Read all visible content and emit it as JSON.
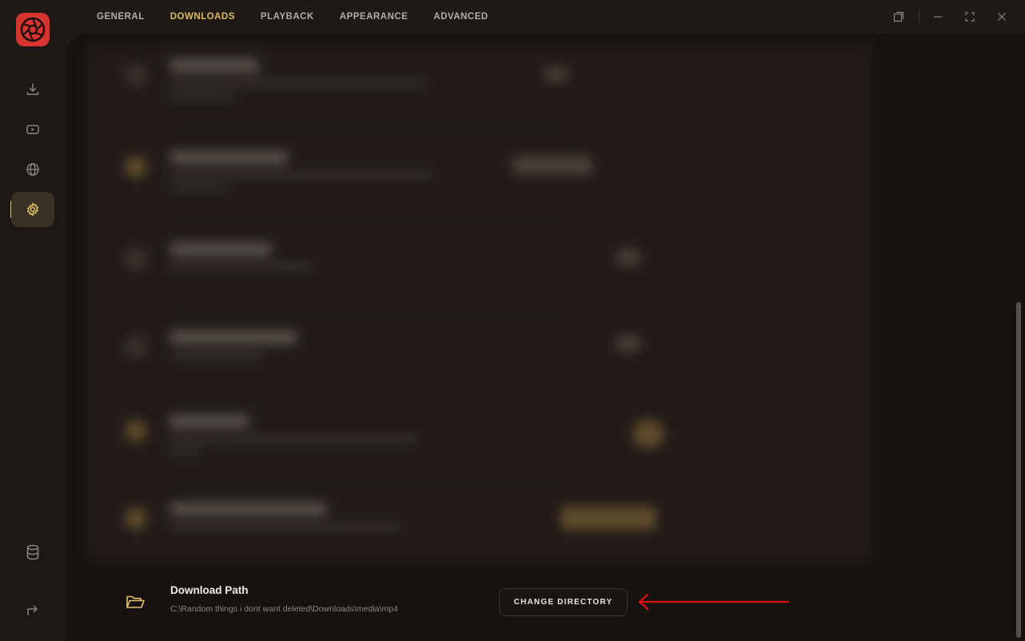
{
  "tabs": [
    {
      "label": "GENERAL",
      "active": false
    },
    {
      "label": "DOWNLOADS",
      "active": true
    },
    {
      "label": "PLAYBACK",
      "active": false
    },
    {
      "label": "APPEARANCE",
      "active": false
    },
    {
      "label": "ADVANCED",
      "active": false
    }
  ],
  "sidebar": {
    "items": [
      {
        "icon": "download-icon"
      },
      {
        "icon": "video-icon"
      },
      {
        "icon": "globe-icon"
      },
      {
        "icon": "settings-icon",
        "active": true
      },
      {
        "icon": "database-icon"
      },
      {
        "icon": "logout-icon"
      }
    ]
  },
  "window_controls": [
    "restore-window-icon",
    "minimize-icon",
    "maximize-icon",
    "close-icon"
  ],
  "download_path": {
    "title": "Download Path",
    "value": "C:\\Random things i dont want deleted\\Downloads\\media\\mp4",
    "button_label": "CHANGE DIRECTORY"
  },
  "colors": {
    "accent": "#d9bb63",
    "logo": "#d6352f",
    "annotation_arrow": "#e01010"
  }
}
